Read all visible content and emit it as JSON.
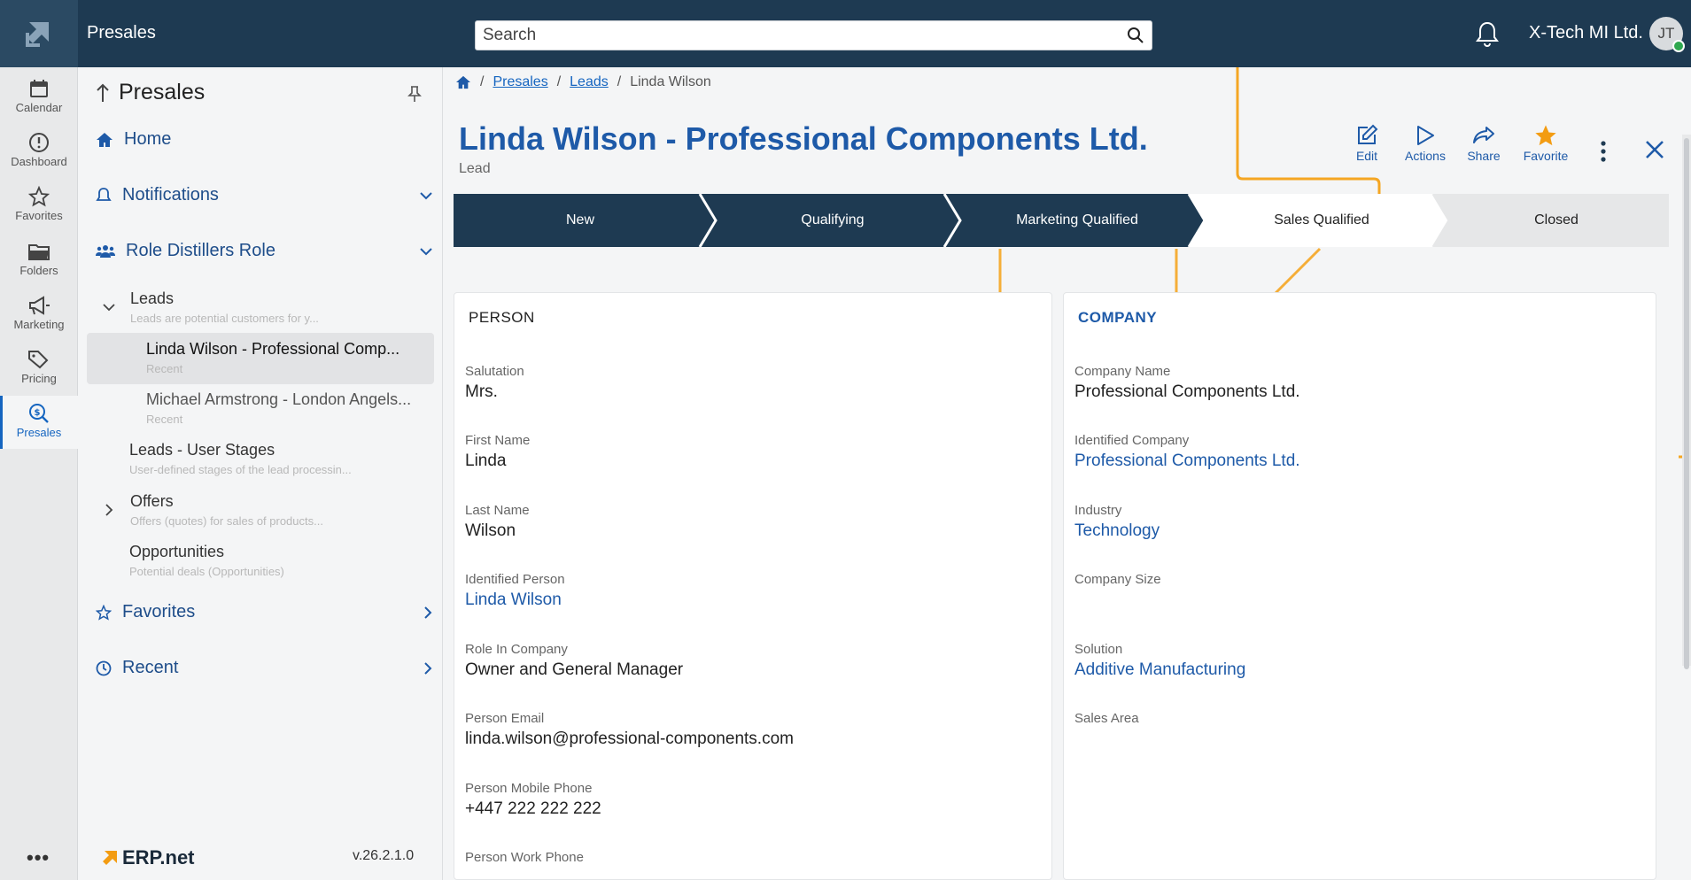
{
  "app": {
    "title": "Presales",
    "company": "X-Tech MI Ltd.",
    "user_initials": "JT"
  },
  "search": {
    "placeholder": "Search"
  },
  "rail": [
    {
      "label": "Calendar",
      "icon": "calendar-icon"
    },
    {
      "label": "Dashboard",
      "icon": "dashboard-icon"
    },
    {
      "label": "Favorites",
      "icon": "star-icon"
    },
    {
      "label": "Folders",
      "icon": "folder-icon"
    },
    {
      "label": "Marketing",
      "icon": "megaphone-icon"
    },
    {
      "label": "Pricing",
      "icon": "tags-icon"
    },
    {
      "label": "Presales",
      "icon": "presales-icon"
    }
  ],
  "nav": {
    "header": "Presales",
    "home": "Home",
    "notifications": "Notifications",
    "role": "Role Distillers Role",
    "tree": {
      "leads": {
        "label": "Leads",
        "desc": "Leads are potential customers for y..."
      },
      "item1": {
        "label": "Linda Wilson - Professional Comp...",
        "desc": "Recent"
      },
      "item2": {
        "label": "Michael Armstrong - London Angels...",
        "desc": "Recent"
      },
      "user_stages": {
        "label": "Leads - User Stages",
        "desc": "User-defined stages of the lead processin..."
      },
      "offers": {
        "label": "Offers",
        "desc": "Offers (quotes) for sales of products..."
      },
      "opportunities": {
        "label": "Opportunities",
        "desc": "Potential deals (Opportunities)"
      }
    },
    "favorites": "Favorites",
    "recent": "Recent",
    "brand": "ERP.net",
    "version": "v.26.2.1.0"
  },
  "breadcrumb": {
    "presales": "Presales",
    "leads": "Leads",
    "current": "Linda Wilson"
  },
  "record": {
    "title": "Linda Wilson - Professional Components Ltd.",
    "type": "Lead"
  },
  "actions": {
    "edit": "Edit",
    "actions": "Actions",
    "share": "Share",
    "favorite": "Favorite"
  },
  "stages": [
    "New",
    "Qualifying",
    "Marketing Qualified",
    "Sales Qualified",
    "Closed"
  ],
  "person": {
    "title": "PERSON",
    "fields": [
      {
        "label": "Salutation",
        "value": "Mrs."
      },
      {
        "label": "First Name",
        "value": "Linda"
      },
      {
        "label": "Last Name",
        "value": "Wilson"
      },
      {
        "label": "Identified Person",
        "value": "Linda Wilson"
      },
      {
        "label": "Role In Company",
        "value": "Owner and General Manager"
      },
      {
        "label": "Person Email",
        "value": "linda.wilson@professional-components.com"
      },
      {
        "label": "Person Mobile Phone",
        "value": "+447 222 222 222"
      },
      {
        "label": "Person Work Phone",
        "value": ""
      }
    ]
  },
  "company": {
    "title": "COMPANY",
    "fields": [
      {
        "label": "Company Name",
        "value": "Professional Components Ltd."
      },
      {
        "label": "Identified Company",
        "value": "Professional Components Ltd."
      },
      {
        "label": "Industry",
        "value": "Technology"
      },
      {
        "label": "Company Size",
        "value": ""
      },
      {
        "label": "Solution",
        "value": "Additive Manufacturing"
      },
      {
        "label": "Sales Area",
        "value": ""
      }
    ]
  },
  "colors": {
    "accent": "#1e5aa8",
    "header": "#1e3a52",
    "favorite": "#f39c12",
    "deco": "#f5a623"
  }
}
